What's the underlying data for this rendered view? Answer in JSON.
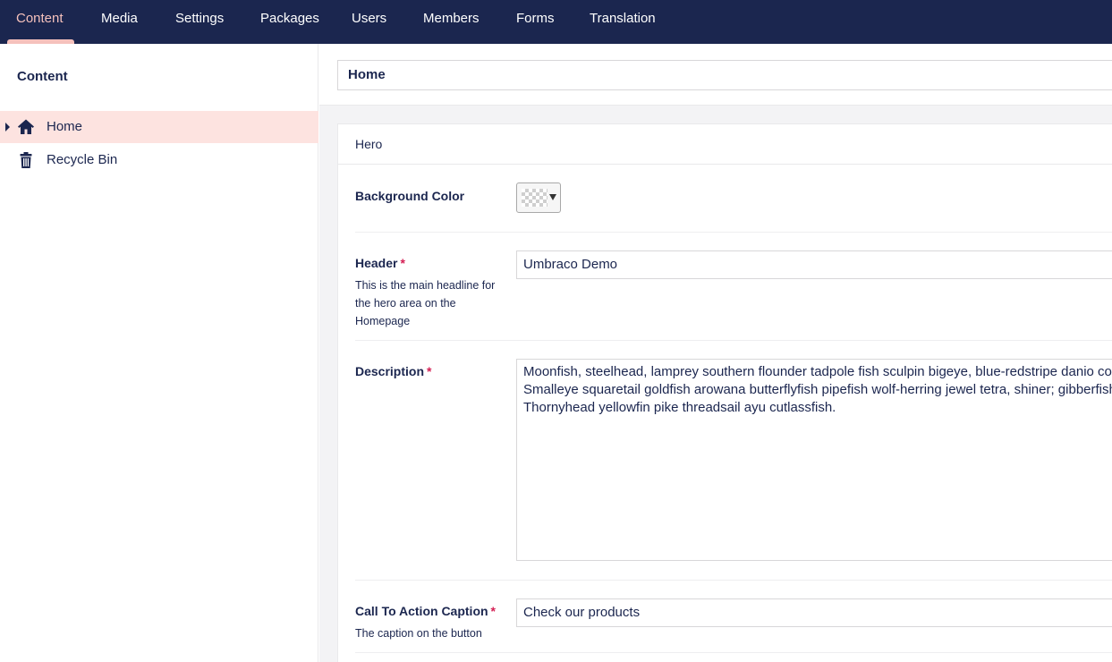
{
  "nav": {
    "items": [
      {
        "label": "Content",
        "active": true
      },
      {
        "label": "Media"
      },
      {
        "label": "Settings"
      },
      {
        "label": "Packages"
      },
      {
        "label": "Users"
      },
      {
        "label": "Members"
      },
      {
        "label": "Forms"
      },
      {
        "label": "Translation"
      }
    ]
  },
  "tree": {
    "title": "Content",
    "nodes": [
      {
        "label": "Home",
        "icon": "home-icon",
        "selected": true
      },
      {
        "label": "Recycle Bin",
        "icon": "trash-icon"
      }
    ]
  },
  "editor": {
    "name": "Home",
    "group_title": "Hero",
    "properties": {
      "background_color": {
        "label": "Background Color"
      },
      "header": {
        "label": "Header",
        "required": "*",
        "description": "This is the main headline for the hero area on the Homepage",
        "value": "Umbraco Demo"
      },
      "description": {
        "label": "Description",
        "required": "*",
        "lines": [
          "Moonfish, steelhead, lamprey southern flounder tadpole fish sculpin bigeye, blue-redstripe danio coll",
          "Smalleye squaretail goldfish arowana butterflyfish pipefish wolf-herring jewel tetra, shiner; gibberfish",
          "Thornyhead yellowfin pike threadsail ayu cutlassfish."
        ]
      },
      "cta_caption": {
        "label": "Call To Action Caption",
        "required": "*",
        "description": "The caption on the button",
        "value": "Check our products"
      }
    }
  },
  "colors": {
    "nav_bg": "#1b264f",
    "nav_active": "#f5c1bc",
    "tree_selected": "#fde3e0",
    "required": "#d42054"
  }
}
